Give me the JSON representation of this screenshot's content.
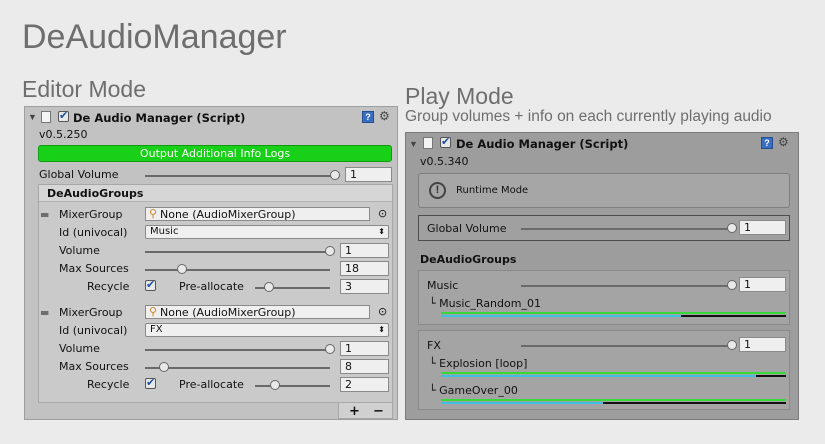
{
  "page": {
    "title": "DeAudioManager",
    "editor_heading": "Editor Mode",
    "play_heading": "Play Mode",
    "play_subheading": "Group volumes + info on each currently playing audio"
  },
  "editor": {
    "component_title": "De Audio Manager (Script)",
    "version": "v0.5.250",
    "log_button": "Output Additional Info Logs",
    "global_volume_label": "Global Volume",
    "global_volume_value": "1",
    "groups_header": "DeAudioGroups",
    "groups": [
      {
        "mixer_label": "MixerGroup",
        "mixer_value": "None (AudioMixerGroup)",
        "id_label": "Id (univocal)",
        "id_value": "Music",
        "volume_label": "Volume",
        "volume_value": "1",
        "max_sources_label": "Max Sources",
        "max_sources_value": "18",
        "recycle_label": "Recycle",
        "preallocate_label": "Pre-allocate",
        "preallocate_value": "3"
      },
      {
        "mixer_label": "MixerGroup",
        "mixer_value": "None (AudioMixerGroup)",
        "id_label": "Id (univocal)",
        "id_value": "FX",
        "volume_label": "Volume",
        "volume_value": "1",
        "max_sources_label": "Max Sources",
        "max_sources_value": "8",
        "recycle_label": "Recycle",
        "preallocate_label": "Pre-allocate",
        "preallocate_value": "2"
      }
    ],
    "add_label": "+",
    "remove_label": "−"
  },
  "play": {
    "component_title": "De Audio Manager (Script)",
    "version": "v0.5.340",
    "runtime_mode": "Runtime Mode",
    "global_volume_label": "Global Volume",
    "global_volume_value": "1",
    "groups_header": "DeAudioGroups",
    "groups": [
      {
        "name": "Music",
        "volume_value": "1",
        "audios": [
          {
            "label": "└ Music_Random_01"
          }
        ]
      },
      {
        "name": "FX",
        "volume_value": "1",
        "audios": [
          {
            "label": "└ Explosion [loop]"
          },
          {
            "label": "└ GameOver_00"
          }
        ]
      }
    ]
  },
  "colors": {
    "log_button_green": "#19d019",
    "progress_green": "#36d936",
    "progress_cyan": "#3fc0e0"
  }
}
